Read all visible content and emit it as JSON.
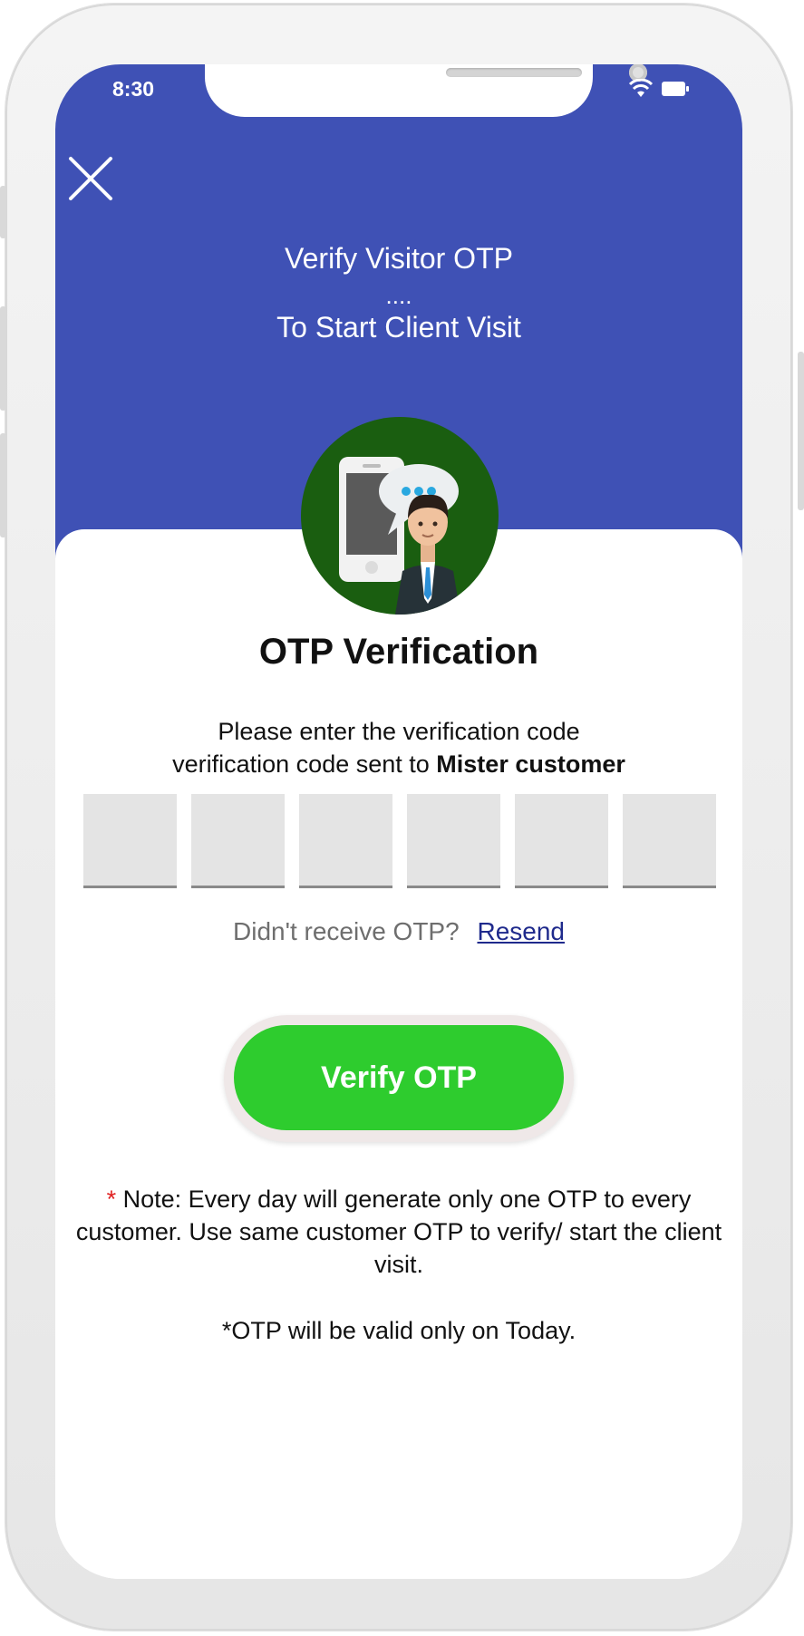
{
  "status_bar": {
    "time": "8:30"
  },
  "header": {
    "title_line1": "Verify Visitor OTP",
    "title_line2": "....",
    "title_line3": "To Start Client Visit"
  },
  "otp": {
    "title": "OTP Verification",
    "description_line1": "Please enter the verification code",
    "description_line2_prefix": "verification code sent to ",
    "recipient": "Mister customer",
    "boxes": [
      "",
      "",
      "",
      "",
      "",
      ""
    ]
  },
  "resend": {
    "question": "Didn't receive OTP?",
    "link_label": "Resend"
  },
  "verify_button_label": "Verify OTP",
  "note": {
    "asterisk": "*",
    "text": " Note: Every day will generate only one OTP to every customer. Use same customer OTP to verify/ start the client visit.",
    "validity": "*OTP will be valid only on Today."
  },
  "colors": {
    "header_bg": "#3f51b5",
    "verify_button": "#2ecc2e",
    "avatar_circle": "#1a5e10",
    "link": "#1f2a8c",
    "note_asterisk": "#e02020"
  },
  "icons": [
    "close-icon",
    "wifi-icon",
    "battery-icon",
    "phone-chat-illustration",
    "businessman-illustration"
  ]
}
